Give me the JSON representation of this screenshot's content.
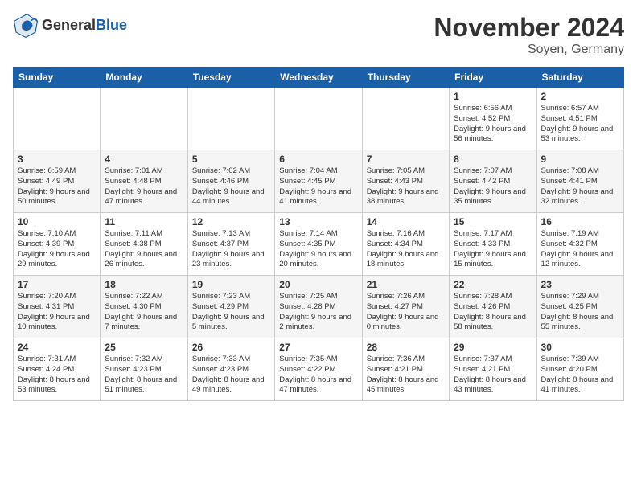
{
  "header": {
    "logo_general": "General",
    "logo_blue": "Blue",
    "month_title": "November 2024",
    "location": "Soyen, Germany"
  },
  "weekdays": [
    "Sunday",
    "Monday",
    "Tuesday",
    "Wednesday",
    "Thursday",
    "Friday",
    "Saturday"
  ],
  "weeks": [
    [
      {
        "day": "",
        "info": ""
      },
      {
        "day": "",
        "info": ""
      },
      {
        "day": "",
        "info": ""
      },
      {
        "day": "",
        "info": ""
      },
      {
        "day": "",
        "info": ""
      },
      {
        "day": "1",
        "info": "Sunrise: 6:56 AM\nSunset: 4:52 PM\nDaylight: 9 hours and 56 minutes."
      },
      {
        "day": "2",
        "info": "Sunrise: 6:57 AM\nSunset: 4:51 PM\nDaylight: 9 hours and 53 minutes."
      }
    ],
    [
      {
        "day": "3",
        "info": "Sunrise: 6:59 AM\nSunset: 4:49 PM\nDaylight: 9 hours and 50 minutes."
      },
      {
        "day": "4",
        "info": "Sunrise: 7:01 AM\nSunset: 4:48 PM\nDaylight: 9 hours and 47 minutes."
      },
      {
        "day": "5",
        "info": "Sunrise: 7:02 AM\nSunset: 4:46 PM\nDaylight: 9 hours and 44 minutes."
      },
      {
        "day": "6",
        "info": "Sunrise: 7:04 AM\nSunset: 4:45 PM\nDaylight: 9 hours and 41 minutes."
      },
      {
        "day": "7",
        "info": "Sunrise: 7:05 AM\nSunset: 4:43 PM\nDaylight: 9 hours and 38 minutes."
      },
      {
        "day": "8",
        "info": "Sunrise: 7:07 AM\nSunset: 4:42 PM\nDaylight: 9 hours and 35 minutes."
      },
      {
        "day": "9",
        "info": "Sunrise: 7:08 AM\nSunset: 4:41 PM\nDaylight: 9 hours and 32 minutes."
      }
    ],
    [
      {
        "day": "10",
        "info": "Sunrise: 7:10 AM\nSunset: 4:39 PM\nDaylight: 9 hours and 29 minutes."
      },
      {
        "day": "11",
        "info": "Sunrise: 7:11 AM\nSunset: 4:38 PM\nDaylight: 9 hours and 26 minutes."
      },
      {
        "day": "12",
        "info": "Sunrise: 7:13 AM\nSunset: 4:37 PM\nDaylight: 9 hours and 23 minutes."
      },
      {
        "day": "13",
        "info": "Sunrise: 7:14 AM\nSunset: 4:35 PM\nDaylight: 9 hours and 20 minutes."
      },
      {
        "day": "14",
        "info": "Sunrise: 7:16 AM\nSunset: 4:34 PM\nDaylight: 9 hours and 18 minutes."
      },
      {
        "day": "15",
        "info": "Sunrise: 7:17 AM\nSunset: 4:33 PM\nDaylight: 9 hours and 15 minutes."
      },
      {
        "day": "16",
        "info": "Sunrise: 7:19 AM\nSunset: 4:32 PM\nDaylight: 9 hours and 12 minutes."
      }
    ],
    [
      {
        "day": "17",
        "info": "Sunrise: 7:20 AM\nSunset: 4:31 PM\nDaylight: 9 hours and 10 minutes."
      },
      {
        "day": "18",
        "info": "Sunrise: 7:22 AM\nSunset: 4:30 PM\nDaylight: 9 hours and 7 minutes."
      },
      {
        "day": "19",
        "info": "Sunrise: 7:23 AM\nSunset: 4:29 PM\nDaylight: 9 hours and 5 minutes."
      },
      {
        "day": "20",
        "info": "Sunrise: 7:25 AM\nSunset: 4:28 PM\nDaylight: 9 hours and 2 minutes."
      },
      {
        "day": "21",
        "info": "Sunrise: 7:26 AM\nSunset: 4:27 PM\nDaylight: 9 hours and 0 minutes."
      },
      {
        "day": "22",
        "info": "Sunrise: 7:28 AM\nSunset: 4:26 PM\nDaylight: 8 hours and 58 minutes."
      },
      {
        "day": "23",
        "info": "Sunrise: 7:29 AM\nSunset: 4:25 PM\nDaylight: 8 hours and 55 minutes."
      }
    ],
    [
      {
        "day": "24",
        "info": "Sunrise: 7:31 AM\nSunset: 4:24 PM\nDaylight: 8 hours and 53 minutes."
      },
      {
        "day": "25",
        "info": "Sunrise: 7:32 AM\nSunset: 4:23 PM\nDaylight: 8 hours and 51 minutes."
      },
      {
        "day": "26",
        "info": "Sunrise: 7:33 AM\nSunset: 4:23 PM\nDaylight: 8 hours and 49 minutes."
      },
      {
        "day": "27",
        "info": "Sunrise: 7:35 AM\nSunset: 4:22 PM\nDaylight: 8 hours and 47 minutes."
      },
      {
        "day": "28",
        "info": "Sunrise: 7:36 AM\nSunset: 4:21 PM\nDaylight: 8 hours and 45 minutes."
      },
      {
        "day": "29",
        "info": "Sunrise: 7:37 AM\nSunset: 4:21 PM\nDaylight: 8 hours and 43 minutes."
      },
      {
        "day": "30",
        "info": "Sunrise: 7:39 AM\nSunset: 4:20 PM\nDaylight: 8 hours and 41 minutes."
      }
    ]
  ]
}
